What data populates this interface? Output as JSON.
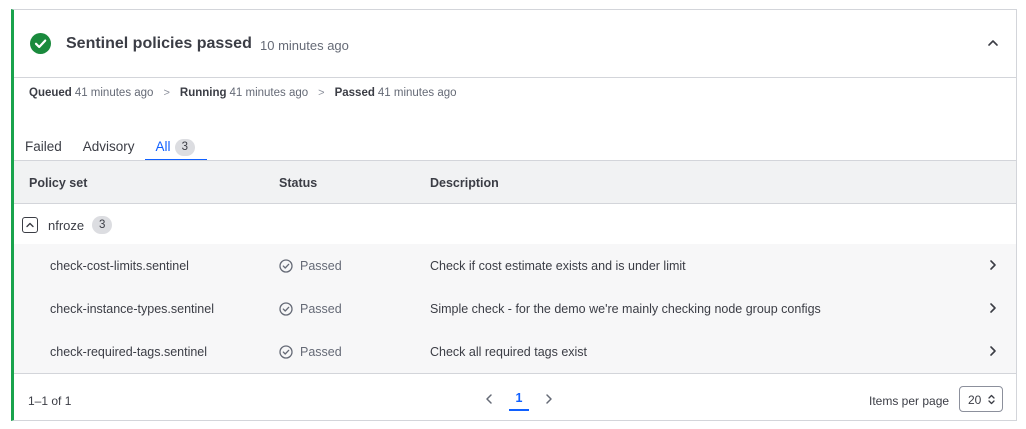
{
  "header": {
    "title": "Sentinel policies passed",
    "time": "10 minutes ago",
    "status_color": "#1a8a3d"
  },
  "timeline": [
    {
      "label": "Queued",
      "time": "41 minutes ago"
    },
    {
      "label": "Running",
      "time": "41 minutes ago"
    },
    {
      "label": "Passed",
      "time": "41 minutes ago"
    }
  ],
  "timeline_separator": ">",
  "tabs": [
    {
      "label": "Failed"
    },
    {
      "label": "Advisory"
    },
    {
      "label": "All",
      "count": "3",
      "active": true
    }
  ],
  "table": {
    "columns": [
      "Policy set",
      "Status",
      "Description"
    ],
    "group": {
      "name": "nfroze",
      "count": "3"
    },
    "rows": [
      {
        "policy": "check-cost-limits.sentinel",
        "status": "Passed",
        "description": "Check if cost estimate exists and is under limit"
      },
      {
        "policy": "check-instance-types.sentinel",
        "status": "Passed",
        "description": "Simple check - for the demo we're mainly checking node group configs"
      },
      {
        "policy": "check-required-tags.sentinel",
        "status": "Passed",
        "description": "Check all required tags exist"
      }
    ]
  },
  "footer": {
    "range": "1–1 of 1",
    "current_page": "1",
    "items_per_page_label": "Items per page",
    "items_per_page_value": "20"
  },
  "colors": {
    "accent": "#1060ff",
    "success": "#1a8a3d",
    "card_left_border": "#19a34c"
  }
}
